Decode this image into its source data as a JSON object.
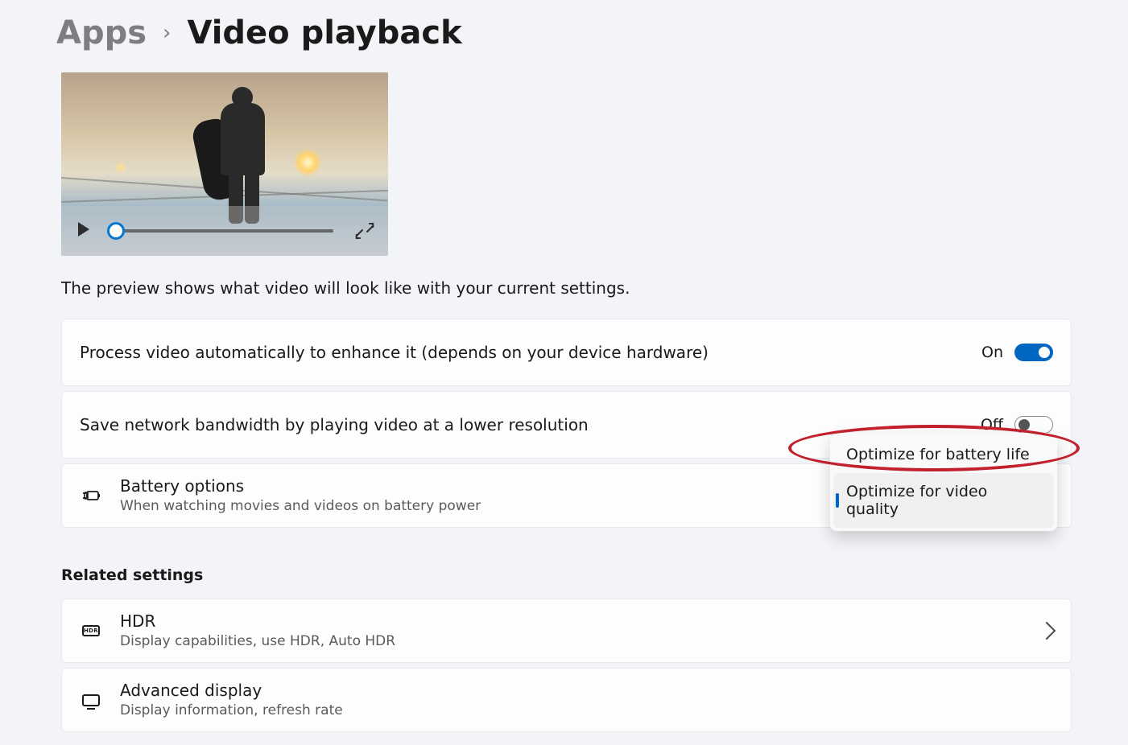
{
  "breadcrumb": {
    "parent": "Apps",
    "current": "Video playback"
  },
  "preview": {
    "caption": "The preview shows what video will look like with your current settings."
  },
  "settings": {
    "enhance": {
      "title": "Process video automatically to enhance it (depends on your device hardware)",
      "state_label": "On"
    },
    "bandwidth": {
      "title": "Save network bandwidth by playing video at a lower resolution",
      "state_label": "Off"
    },
    "battery": {
      "title": "Battery options",
      "subtitle": "When watching movies and videos on battery power",
      "dropdown": {
        "option1": "Optimize for battery life",
        "option2": "Optimize for video quality"
      }
    }
  },
  "related": {
    "header": "Related settings",
    "hdr": {
      "title": "HDR",
      "subtitle": "Display capabilities, use HDR, Auto HDR",
      "icon_text": "HDR"
    },
    "advanced": {
      "title": "Advanced display",
      "subtitle": "Display information, refresh rate"
    }
  }
}
